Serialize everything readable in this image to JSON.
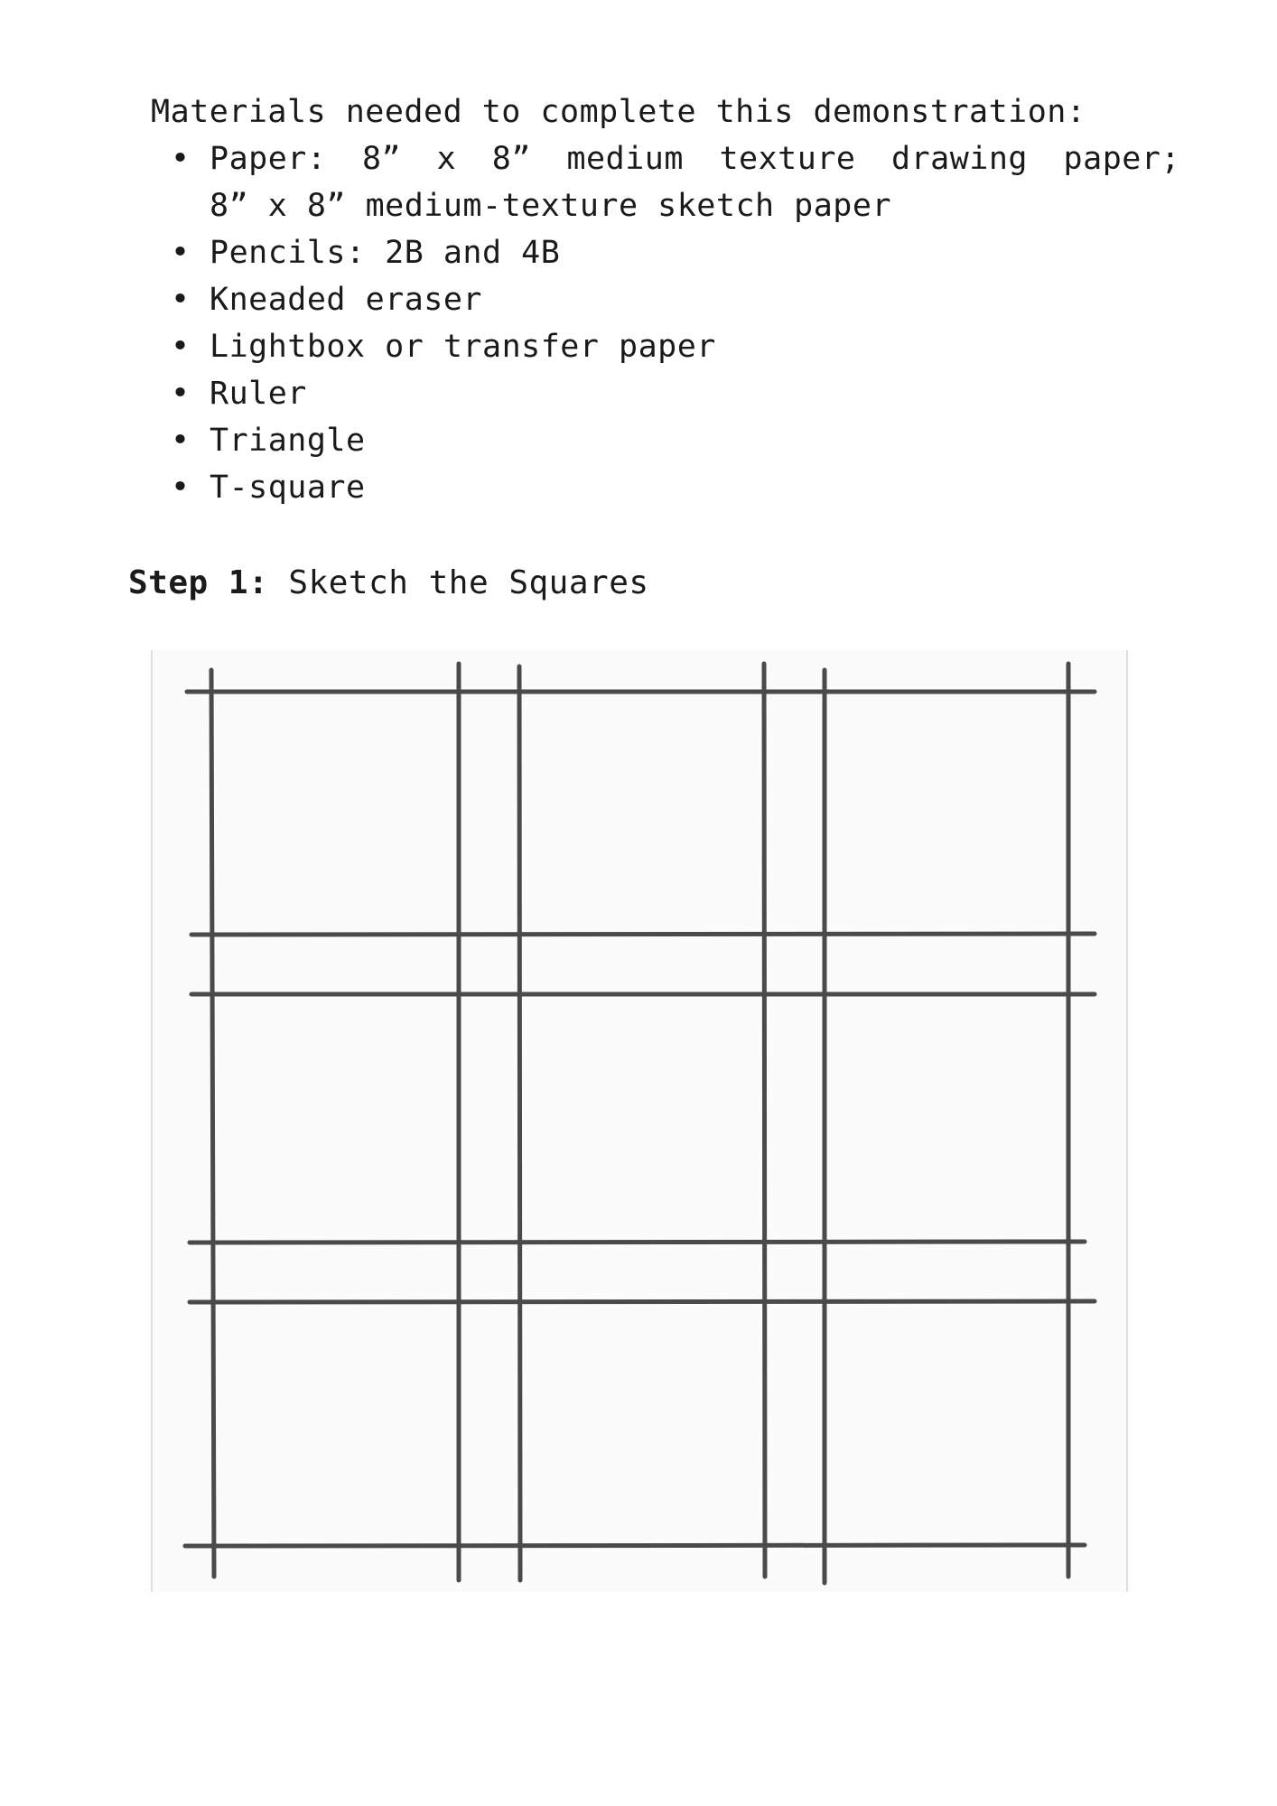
{
  "materials": {
    "heading": "Materials needed to complete this demonstration:",
    "items": [
      {
        "line1": "Paper: 8” x 8” medium texture drawing paper;",
        "line2": "8” x 8” medium-texture sketch paper"
      },
      {
        "line1": "Pencils: 2B and 4B"
      },
      {
        "line1": "Kneaded eraser"
      },
      {
        "line1": "Lightbox or transfer paper"
      },
      {
        "line1": "Ruler"
      },
      {
        "line1": "Triangle"
      },
      {
        "line1": "T-square"
      }
    ],
    "bullet": "•"
  },
  "step": {
    "label": "Step 1:",
    "title": "Sketch the Squares"
  },
  "figure": {
    "line_color": "#4a4a4a",
    "frame_color": "#d8d8d8"
  }
}
